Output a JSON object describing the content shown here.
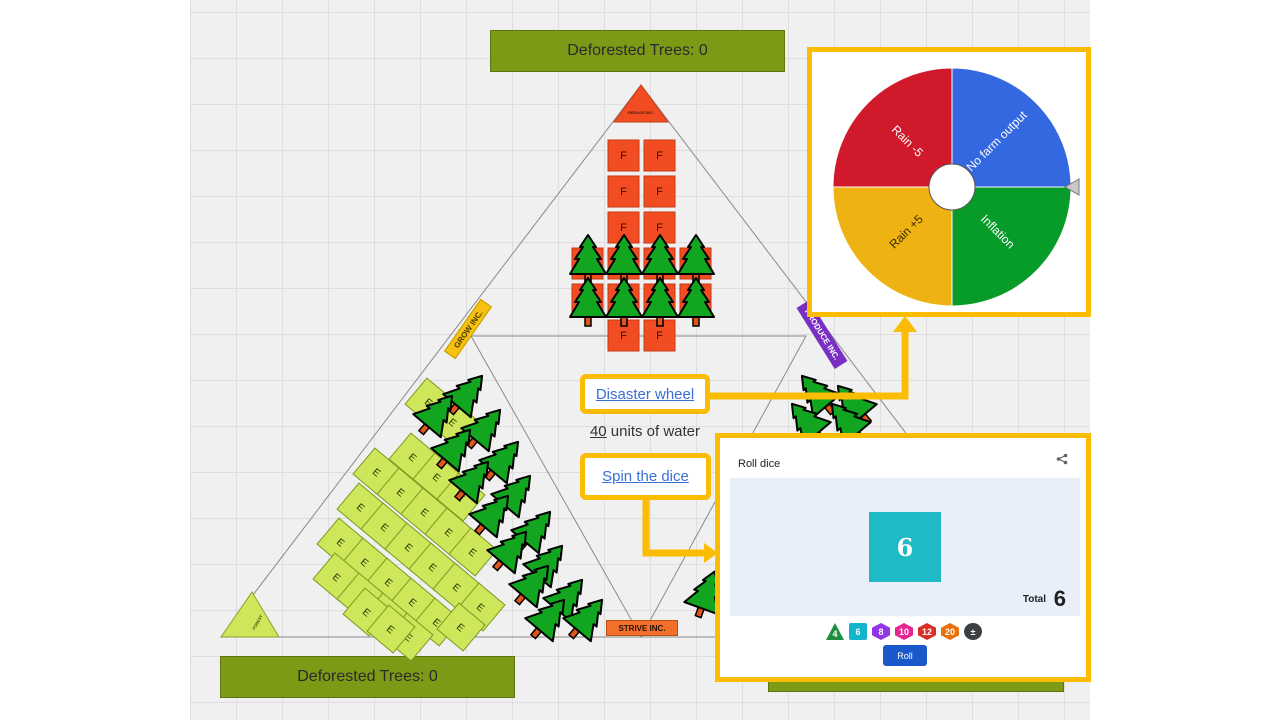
{
  "board": {
    "deforested_top": "Deforested Trees: 0",
    "deforested_bottom_left": "Deforested Trees: 0",
    "tag_grow": "GROW INC.",
    "tag_produce": "PRODUCE INC.",
    "tag_strive": "STRIVE INC.",
    "tag_top": "REDUCE INC.",
    "tag_corner": "FOREST",
    "factory_letter": "F",
    "farm_letter": "E"
  },
  "links": {
    "disaster_wheel": "Disaster wheel",
    "spin_dice": "Spin the dice",
    "water_value": "40",
    "water_suffix": " units of water"
  },
  "wheel": {
    "segments": [
      {
        "label": "Rain -5",
        "color": "#d0192b"
      },
      {
        "label": "No farm output",
        "color": "#3468e0"
      },
      {
        "label": "Inflation",
        "color": "#079b2a"
      },
      {
        "label": "Rain +5",
        "color": "#eeb212"
      }
    ]
  },
  "dice": {
    "title": "Roll dice",
    "share_icon": "share-icon",
    "face_value": "6",
    "total_label": "Total",
    "total_value": "6",
    "chips": [
      {
        "label": "4",
        "color": "#1e8e3e"
      },
      {
        "label": "6",
        "color": "#12b5cb"
      },
      {
        "label": "8",
        "color": "#9334e6"
      },
      {
        "label": "10",
        "color": "#e52592"
      },
      {
        "label": "12",
        "color": "#d93025"
      },
      {
        "label": "20",
        "color": "#e8710a"
      },
      {
        "label": "±",
        "color": "#3c4043"
      }
    ],
    "roll_label": "Roll"
  },
  "colors": {
    "highlight": "#fbbc04",
    "deforest_bg": "#7d9a17",
    "factory": "#f24d22",
    "farm": "#cde65a",
    "tree": "#12a51f"
  }
}
